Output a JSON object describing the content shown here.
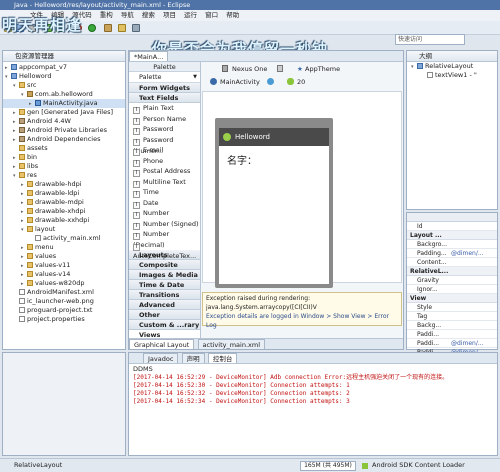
{
  "window": {
    "title": "Java - Helloword/res/layout/activity_main.xml - Eclipse",
    "overlay_left": "明天再相逢",
    "overlay_right": "你是否会为我停留一秒钟"
  },
  "menu": [
    "文件",
    "编辑",
    "源代码",
    "重构",
    "导航",
    "搜索",
    "项目",
    "运行",
    "窗口",
    "帮助"
  ],
  "search": {
    "placeholder": "快速访问"
  },
  "explorer": {
    "title": "包资源管理器",
    "rows": [
      {
        "text": "appcompat_v7",
        "depth": 0,
        "icon": "proj",
        "arrow": "▸"
      },
      {
        "text": "Helloword",
        "depth": 0,
        "icon": "proj",
        "arrow": "▾"
      },
      {
        "text": "src",
        "depth": 1,
        "icon": "folder",
        "arrow": "▾"
      },
      {
        "text": "com.ab.helloword",
        "depth": 2,
        "icon": "pkg",
        "arrow": "▾"
      },
      {
        "text": "MainActivity.java",
        "depth": 3,
        "icon": "java",
        "arrow": "▸",
        "selected": true
      },
      {
        "text": "gen [Generated Java Files]",
        "depth": 1,
        "icon": "folder",
        "arrow": "▸"
      },
      {
        "text": "Android 4.4W",
        "depth": 1,
        "icon": "jar",
        "arrow": "▸"
      },
      {
        "text": "Android Private Libraries",
        "depth": 1,
        "icon": "jar",
        "arrow": "▸"
      },
      {
        "text": "Android Dependencies",
        "depth": 1,
        "icon": "jar",
        "arrow": "▸"
      },
      {
        "text": "assets",
        "depth": 1,
        "icon": "folder",
        "arrow": ""
      },
      {
        "text": "bin",
        "depth": 1,
        "icon": "folder",
        "arrow": "▸"
      },
      {
        "text": "libs",
        "depth": 1,
        "icon": "folder",
        "arrow": "▸"
      },
      {
        "text": "res",
        "depth": 1,
        "icon": "folder",
        "arrow": "▾"
      },
      {
        "text": "drawable-hdpi",
        "depth": 2,
        "icon": "folder",
        "arrow": "▸"
      },
      {
        "text": "drawable-ldpi",
        "depth": 2,
        "icon": "folder",
        "arrow": "▸"
      },
      {
        "text": "drawable-mdpi",
        "depth": 2,
        "icon": "folder",
        "arrow": "▸"
      },
      {
        "text": "drawable-xhdpi",
        "depth": 2,
        "icon": "folder",
        "arrow": "▸"
      },
      {
        "text": "drawable-xxhdpi",
        "depth": 2,
        "icon": "folder",
        "arrow": "▸"
      },
      {
        "text": "layout",
        "depth": 2,
        "icon": "folder",
        "arrow": "▾"
      },
      {
        "text": "activity_main.xml",
        "depth": 3,
        "icon": "file",
        "arrow": ""
      },
      {
        "text": "menu",
        "depth": 2,
        "icon": "folder",
        "arrow": "▸"
      },
      {
        "text": "values",
        "depth": 2,
        "icon": "folder",
        "arrow": "▸"
      },
      {
        "text": "values-v11",
        "depth": 2,
        "icon": "folder",
        "arrow": "▸"
      },
      {
        "text": "values-v14",
        "depth": 2,
        "icon": "folder",
        "arrow": "▸"
      },
      {
        "text": "values-w820dp",
        "depth": 2,
        "icon": "folder",
        "arrow": "▸"
      },
      {
        "text": "AndroidManifest.xml",
        "depth": 1,
        "icon": "file",
        "arrow": ""
      },
      {
        "text": "ic_launcher-web.png",
        "depth": 1,
        "icon": "file",
        "arrow": ""
      },
      {
        "text": "proguard-project.txt",
        "depth": 1,
        "icon": "file",
        "arrow": ""
      },
      {
        "text": "project.properties",
        "depth": 1,
        "icon": "file",
        "arrow": ""
      }
    ]
  },
  "editor": {
    "tab": "*MainA...",
    "palette_label": "Palette",
    "palette_select": "Palette",
    "device": "Nexus One",
    "theme": "AppTheme",
    "activity": "MainActivity",
    "api": "20",
    "palette": {
      "categories_top": [
        "Form Widgets",
        "Text Fields"
      ],
      "items": [
        "Plain Text",
        "Person Name",
        "Password",
        "Password (Numer...",
        "E-mail",
        "Phone",
        "Postal Address",
        "Multiline Text",
        "Time",
        "Date",
        "Number",
        "Number (Signed)",
        "Number (Decimal)",
        "AutoCompleteTex..."
      ],
      "categories_bottom": [
        "Layouts",
        "Composite",
        "Images & Media",
        "Time & Date",
        "Transitions",
        "Advanced",
        "Other",
        "Custom & ...rary Views"
      ]
    },
    "phone": {
      "app_title": "Helloword",
      "label": "名字："
    },
    "error": [
      "Exception raised during rendering:",
      "java.lang.System.arraycopy([CI[CII)V",
      "Exception details are logged in Window > Show View > Error Log"
    ],
    "bottom_tabs": [
      "Graphical Layout",
      "activity_main.xml"
    ]
  },
  "outline": {
    "title": "大纲",
    "items": [
      "RelativeLayout",
      "textView1 - \""
    ]
  },
  "properties": {
    "rows": [
      {
        "type": "row",
        "k": "Id",
        "v": ""
      },
      {
        "type": "cat",
        "k": "Layout ..."
      },
      {
        "type": "row",
        "k": "Backgro...",
        "v": ""
      },
      {
        "type": "row",
        "k": "Padding...",
        "v": "@dimen/..."
      },
      {
        "type": "row",
        "k": "Content...",
        "v": ""
      },
      {
        "type": "cat",
        "k": "RelativeL..."
      },
      {
        "type": "row",
        "k": "Gravity",
        "v": ""
      },
      {
        "type": "row",
        "k": "Ignor...",
        "v": ""
      },
      {
        "type": "cat",
        "k": "View"
      },
      {
        "type": "row",
        "k": "Style",
        "v": ""
      },
      {
        "type": "row",
        "k": "Tag",
        "v": ""
      },
      {
        "type": "row",
        "k": "Backg...",
        "v": ""
      },
      {
        "type": "row",
        "k": "Paddi...",
        "v": ""
      },
      {
        "type": "row",
        "k": "Paddi...",
        "v": "@dimen/..."
      },
      {
        "type": "row",
        "k": "Paddi...",
        "v": "@dimen/..."
      },
      {
        "type": "row",
        "k": "Paddi...",
        "v": ""
      }
    ]
  },
  "console": {
    "tabs": [
      "Javadoc",
      "声明",
      "控制台"
    ],
    "header": "DDMS",
    "lines": [
      "[2017-04-14 16:52:29 - DeviceMonitor] Adb connection Error:远程主机强迫关闭了一个现有的连接。",
      "[2017-04-14 16:52:30 - DeviceMonitor] Connection attempts: 1",
      "[2017-04-14 16:52:32 - DeviceMonitor] Connection attempts: 2",
      "[2017-04-14 16:52:34 - DeviceMonitor] Connection attempts: 3"
    ]
  },
  "status": {
    "left": "RelativeLayout",
    "memory": "165M (共 495M)",
    "loader": "Android SDK Content Loader"
  }
}
